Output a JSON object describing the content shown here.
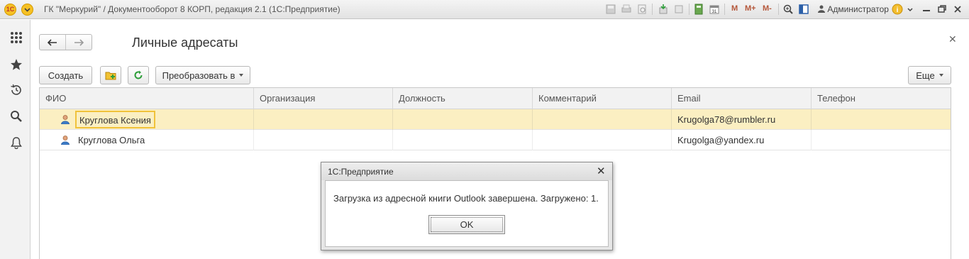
{
  "titlebar": {
    "logo_text": "1С",
    "title": "ГК \"Меркурий\" / Документооборот 8 КОРП, редакция 2.1  (1С:Предприятие)",
    "memory_buttons": [
      "M",
      "M+",
      "M-"
    ],
    "user": "Администратор"
  },
  "form": {
    "title": "Личные адресаты",
    "toolbar": {
      "create_label": "Создать",
      "convert_label": "Преобразовать в",
      "more_label": "Еще"
    },
    "columns": [
      "ФИО",
      "Организация",
      "Должность",
      "Комментарий",
      "Email",
      "Телефон"
    ],
    "rows": [
      {
        "name": "Круглова Ксения",
        "organization": "",
        "position": "",
        "comment": "",
        "email": "Krugolga78@rumbler.ru",
        "phone": "",
        "selected": true
      },
      {
        "name": "Круглова Ольга",
        "organization": "",
        "position": "",
        "comment": "",
        "email": "Krugolga@yandex.ru",
        "phone": "",
        "selected": false
      }
    ]
  },
  "dialog": {
    "title": "1С:Предприятие",
    "message": "Загрузка из адресной книги Outlook завершена. Загружено: 1.",
    "ok_label": "OK"
  },
  "colors": {
    "selected_row": "#fbefc2",
    "selected_cell_border": "#f0c23b",
    "header_bg": "#f2f2f2"
  }
}
